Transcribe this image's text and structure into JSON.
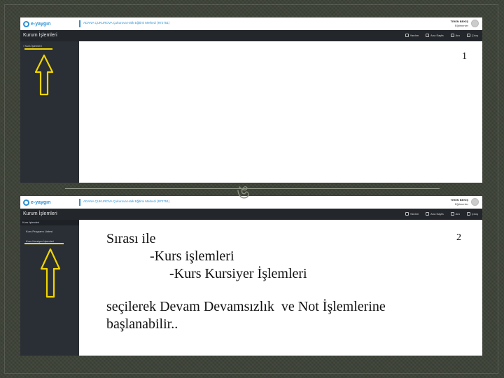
{
  "app": {
    "logo_text": "e-yaygın",
    "org_line": "ADANA ÇUKUROVA Çukurova Halk Eğitimi Merkezi (972751)",
    "user_name": "TEKİN BEKİŞ",
    "user_role": "Eğitmenler"
  },
  "screenshot1": {
    "nav_title": "Kurum İşlemleri",
    "nav_links": [
      "Yardım",
      "Ana Sayfa",
      "Ara",
      "Çıkış"
    ],
    "sidebar_item": "Kurs İşlemleri",
    "slide_number": "1"
  },
  "screenshot2": {
    "nav_title": "Kurum İşlemleri",
    "nav_links": [
      "Yardım",
      "Ana Sayfa",
      "Ara",
      "Çıkış"
    ],
    "sidebar_active": "Kurs İşlemleri",
    "sidebar_items": [
      "Kurs Programı Listesi",
      "Kurs Kursiyer İşlemleri"
    ],
    "slide_number": "2"
  },
  "instructions": {
    "line1": "Sırası ile",
    "line2": "-Kurs işlemleri",
    "line3": "-Kurs Kursiyer İşlemleri",
    "line4": "seçilerek Devam Devamsızlık  ve Not İşlemlerine",
    "line5": "başlanabilir.."
  },
  "ornament": "ঙ",
  "colors": {
    "highlight": "#f2d600",
    "navbar": "#23262b",
    "sidebar": "#2a2e35",
    "brand": "#2d8fd2"
  }
}
